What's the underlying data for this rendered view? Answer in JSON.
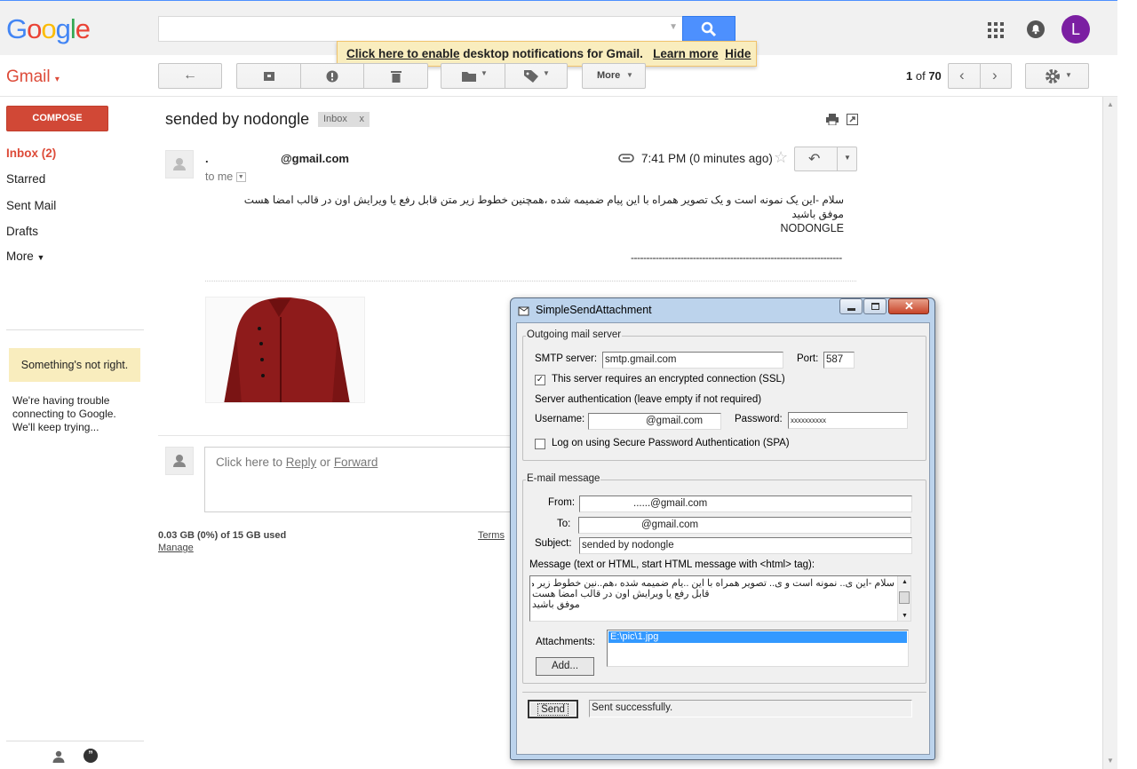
{
  "header": {
    "logo_letters": [
      "G",
      "o",
      "o",
      "g",
      "l",
      "e"
    ],
    "logo_colors": [
      "#4285f4",
      "#ea4335",
      "#fbbc05",
      "#4285f4",
      "#34a853",
      "#ea4335"
    ],
    "search_placeholder": "",
    "avatar_initial": "L"
  },
  "notification": {
    "link_enable": "Click here to enable",
    "text": " desktop notifications for Gmail.",
    "learn_more": "Learn more",
    "hide": "Hide"
  },
  "toolbar": {
    "gmail_label": "Gmail",
    "more_label": "More",
    "pager_current": "1",
    "pager_of": "of",
    "pager_total": "70"
  },
  "sidebar": {
    "compose_label": "COMPOSE",
    "items": [
      {
        "label": "Inbox (2)"
      },
      {
        "label": "Starred"
      },
      {
        "label": "Sent Mail"
      },
      {
        "label": "Drafts"
      },
      {
        "label": "More"
      }
    ],
    "warning_title": "Something's not right.",
    "warning_text": "We're having trouble connecting to Google. We'll keep trying..."
  },
  "message": {
    "subject": "sended by nodongle",
    "label_tag": "Inbox",
    "label_close": "x",
    "sender_prefix": ".",
    "sender_email": "@gmail.com",
    "to_me": "to me",
    "time": "7:41 PM (0 minutes ago)",
    "body_line1": "سلام -این یک نمونه است و یک تصویر همراه با این پیام ضمیمه شده ،همچنین خطوط زیر متن قابل رفع یا  ویرایش اون  در قالب امضا هست",
    "body_line2": "موفق باشید",
    "body_line3": "NODONGLE",
    "body_dashes": "--------------------------------------------------------------------"
  },
  "reply": {
    "prefix": "Click here to ",
    "reply_link": "Reply",
    "or": " or ",
    "forward_link": "Forward"
  },
  "footer": {
    "storage": "0.03 GB (0%) of 15 GB used",
    "manage": "Manage",
    "terms": "Terms"
  },
  "dialog": {
    "title": "SimpleSendAttachment",
    "server_group": "Outgoing mail server",
    "smtp_label": "SMTP server:",
    "smtp_value": "smtp.gmail.com",
    "port_label": "Port:",
    "port_value": "587",
    "ssl_label": "This server requires an encrypted connection (SSL)",
    "auth_label": "Server authentication (leave empty if not required)",
    "username_label": "Username:",
    "username_value": "@gmail.com",
    "password_label": "Password:",
    "password_value": "xxxxxxxxxx",
    "spa_label": "Log on using Secure Password Authentication (SPA)",
    "email_group": "E-mail message",
    "from_label": "From:",
    "from_value": "......@gmail.com",
    "to_label": "To:",
    "to_value": "@gmail.com",
    "subject_label": "Subject:",
    "subject_value": "sended by nodongle",
    "message_label": "Message (text or HTML, start HTML message with <html> tag):",
    "message_line1": "سلام -این ی.. نمونه است و ی.. تصویر همراه با این ..یام ضمیمه شده ،هم..نین خطوط زیر متن",
    "message_line2": "قابل رفع یا  ویرایش اون  در قالب امضا هست",
    "message_line3": "موفق باشید",
    "attachments_label": "Attachments:",
    "attachment_item": "E:\\pic\\1.jpg",
    "add_button": "Add...",
    "send_button": "Send",
    "status": "Sent successfully."
  }
}
